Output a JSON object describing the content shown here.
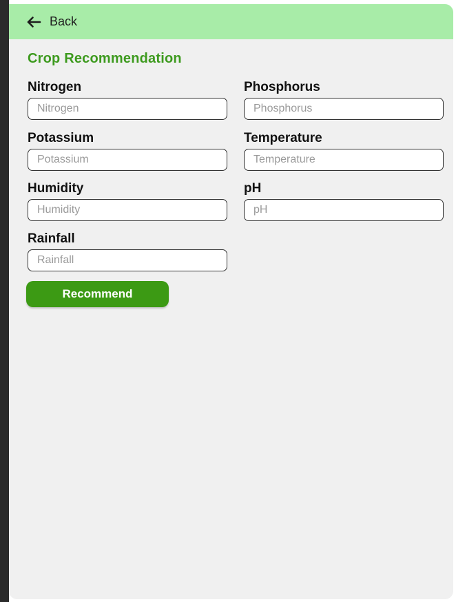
{
  "colors": {
    "header_bg": "#a8eca8",
    "title": "#3d9a1e",
    "button_bg": "#3c9a14",
    "screen_bg": "#f0f0f0"
  },
  "header": {
    "back_icon": "arrow-left-icon",
    "back_label": "Back"
  },
  "page": {
    "title": "Crop Recommendation"
  },
  "form": {
    "nitrogen": {
      "label": "Nitrogen",
      "placeholder": "Nitrogen",
      "value": ""
    },
    "phosphorus": {
      "label": "Phosphorus",
      "placeholder": "Phosphorus",
      "value": ""
    },
    "potassium": {
      "label": "Potassium",
      "placeholder": "Potassium",
      "value": ""
    },
    "temperature": {
      "label": "Temperature",
      "placeholder": "Temperature",
      "value": ""
    },
    "humidity": {
      "label": "Humidity",
      "placeholder": "Humidity",
      "value": ""
    },
    "ph": {
      "label": "pH",
      "placeholder": "pH",
      "value": ""
    },
    "rainfall": {
      "label": "Rainfall",
      "placeholder": "Rainfall",
      "value": ""
    },
    "submit_label": "Recommend"
  }
}
